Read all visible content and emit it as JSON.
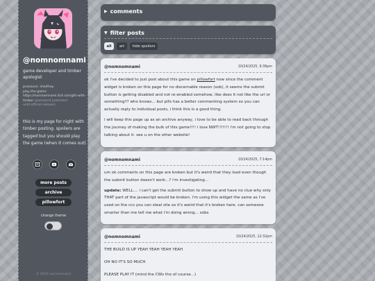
{
  "profile": {
    "handle": "@nomnomnami",
    "bio": "game developer and timber apologist",
    "meta_pronouns": "pronouns: she/they",
    "meta_play": "play the game:",
    "meta_link": "https://nomnomnami.itch.io/night-with-timber",
    "meta_pw": "(password protected",
    "meta_until": "until official release)",
    "about": "this is my page for night with timber posting. spoilers are tagged but you should play the game (when it comes out)"
  },
  "social_icons": [
    "home-icon",
    "youtube-icon",
    "mail-icon"
  ],
  "nav": [
    "more posts",
    "archive",
    "pillowfort"
  ],
  "theme": {
    "label": "change theme"
  },
  "copyright": "© 2025 nomnomnami",
  "comments": {
    "title": "comments"
  },
  "filter": {
    "title": "filter posts",
    "chips": [
      "all",
      "art",
      "hide spoilers"
    ]
  },
  "posts": [
    {
      "author": "@nomnomnami",
      "date": "10/24/2025, 9:36pm",
      "p1_before": "ok i've decided to just post about this game on ",
      "p1_link": "pillowfort",
      "p1_after": " now since the comment widget is broken on this page for no discernable reason (sob), it seems the submit button is getting disabled and not re-enabled somehow, like does it not like the url or something?? who knows... but pifo has a better commenting system so you can actually reply to individual posts, i think this is a good thing.",
      "p2": "i will keep this page up as an archive anyway, i love to be able to read back through the journey of making the bulk of this game!!!! i love NWT!!!!!!! i'm not going to stop talking about it. see u on the other website!"
    },
    {
      "author": "@nomnomnami",
      "date": "10/24/2025, 7:14pm",
      "p1": "um ok comments on this page are broken but it's weird that they load even though the submit button doesn't work...? i'm investigating...",
      "p2_bold": "update:",
      "p2": " WELL.... i can't get the submit button to show up and have no clue why only THAT part of the javascript would be broken. i'm using this widget the same as i've used on the ccs you can steal site so it's weird that it's broken here. can someone smarter than me tell me what i'm doing wrong... sobs"
    },
    {
      "author": "@nomnomnami",
      "date": "10/24/2025, 12:32pm",
      "p1": "THE BUILD IS UP YEAH YEAH YEAH YEAH",
      "p2": "OH NO IT'S SO MUCH",
      "p3": "PLEASE PLAY IT (mind the CWs tho of course...)"
    }
  ],
  "colors": {
    "panel": "#52575f",
    "post_bg": "#eef0f3",
    "button": "#2d3035",
    "background": "#a6a9ae"
  }
}
